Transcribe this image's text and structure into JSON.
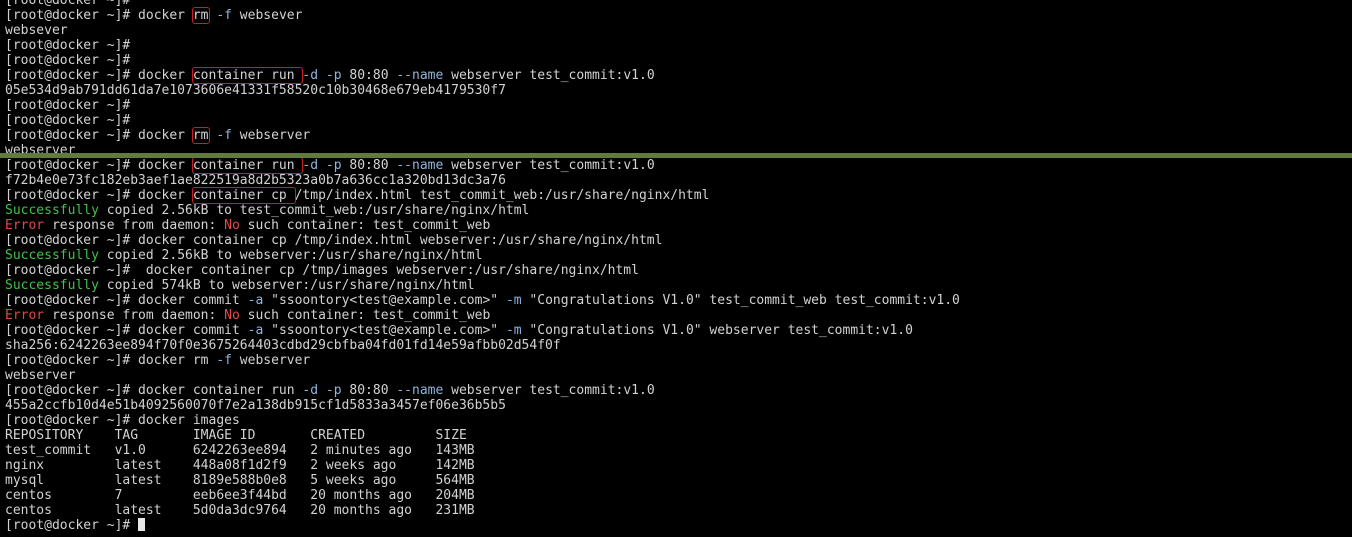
{
  "prompt": "[root@docker ~]#",
  "colors": {
    "background": "#000000",
    "text": "#d2d2d2",
    "success": "#44c04b",
    "error": "#e04848",
    "option": "#8fb4dc",
    "highlight_box": "#c62020",
    "divider": "#5f7f2e"
  },
  "top_pane": [
    {
      "segs": [
        {
          "text": "[root@docker ~]#"
        }
      ]
    },
    {
      "segs": [
        {
          "text": "[root@docker ~]# docker "
        },
        {
          "text": "rm",
          "cls": "hl",
          "name": "highlight-rm"
        },
        {
          "text": " "
        },
        {
          "text": "-f",
          "cls": "flag"
        },
        {
          "text": " websever"
        }
      ]
    },
    {
      "segs": [
        {
          "text": "websever"
        }
      ]
    },
    {
      "segs": [
        {
          "text": "[root@docker ~]#"
        }
      ]
    },
    {
      "segs": [
        {
          "text": "[root@docker ~]#"
        }
      ]
    },
    {
      "segs": [
        {
          "text": "[root@docker ~]# docker "
        },
        {
          "text": "container run ",
          "cls": "hl",
          "name": "highlight-container-run"
        },
        {
          "text": "-d",
          "cls": "flag"
        },
        {
          "text": " "
        },
        {
          "text": "-p",
          "cls": "flag"
        },
        {
          "text": " 80:80 "
        },
        {
          "text": "--name",
          "cls": "flag"
        },
        {
          "text": " webserver test_commit:v1.0"
        }
      ]
    },
    {
      "segs": [
        {
          "text": "05e534d9ab791dd61da7e1073606e41331f58520c10b30468e679eb4179530f7"
        }
      ]
    },
    {
      "segs": [
        {
          "text": "[root@docker ~]#"
        }
      ]
    },
    {
      "segs": [
        {
          "text": "[root@docker ~]#"
        }
      ]
    },
    {
      "segs": [
        {
          "text": "[root@docker ~]# docker "
        },
        {
          "text": "rm",
          "cls": "hl",
          "name": "highlight-rm"
        },
        {
          "text": " "
        },
        {
          "text": "-f",
          "cls": "flag"
        },
        {
          "text": " webserver"
        }
      ]
    },
    {
      "segs": [
        {
          "text": "webserver"
        }
      ]
    }
  ],
  "bottom_pane": [
    {
      "segs": [
        {
          "text": "[root@docker ~]# docker "
        },
        {
          "text": "container run ",
          "cls": "hl",
          "name": "highlight-container-run"
        },
        {
          "text": "-d",
          "cls": "flag"
        },
        {
          "text": " "
        },
        {
          "text": "-p",
          "cls": "flag"
        },
        {
          "text": " 80:80 "
        },
        {
          "text": "--name",
          "cls": "flag"
        },
        {
          "text": " webserver test_commit:v1.0"
        }
      ]
    },
    {
      "segs": [
        {
          "text": "f72b4e0e73fc182eb3aef1ae822519a8d2b5323a0b7a636cc1a320bd13dc3a76"
        }
      ]
    },
    {
      "segs": [
        {
          "text": "[root@docker ~]# docker "
        },
        {
          "text": "container cp ",
          "cls": "hl",
          "name": "highlight-container-cp"
        },
        {
          "text": "/tmp/index.html test_commit_web:/usr/share/nginx/html"
        }
      ]
    },
    {
      "segs": [
        {
          "text": "Successfully",
          "cls": "ok"
        },
        {
          "text": " copied 2.56kB to test_commit_web:/usr/share/nginx/html"
        }
      ]
    },
    {
      "segs": [
        {
          "text": "Error",
          "cls": "err"
        },
        {
          "text": " response from daemon: "
        },
        {
          "text": "No",
          "cls": "no"
        },
        {
          "text": " such container: test_commit_web"
        }
      ]
    },
    {
      "segs": [
        {
          "text": "[root@docker ~]# docker container cp /tmp/index.html webserver:/usr/share/nginx/html"
        }
      ]
    },
    {
      "segs": [
        {
          "text": "Successfully",
          "cls": "ok"
        },
        {
          "text": " copied 2.56kB to webserver:/usr/share/nginx/html"
        }
      ]
    },
    {
      "segs": [
        {
          "text": "[root@docker ~]#  docker container cp /tmp/images webserver:/usr/share/nginx/html"
        }
      ]
    },
    {
      "segs": [
        {
          "text": "Successfully",
          "cls": "ok"
        },
        {
          "text": " copied 574kB to webserver:/usr/share/nginx/html"
        }
      ]
    },
    {
      "segs": [
        {
          "text": "[root@docker ~]# docker commit "
        },
        {
          "text": "-a",
          "cls": "flag"
        },
        {
          "text": " \"ssoontory<test@example.com>\" "
        },
        {
          "text": "-m",
          "cls": "flag"
        },
        {
          "text": " \"Congratulations V1.0\" test_commit_web test_commit:v1.0"
        }
      ]
    },
    {
      "segs": [
        {
          "text": "Error",
          "cls": "err"
        },
        {
          "text": " response from daemon: "
        },
        {
          "text": "No",
          "cls": "no"
        },
        {
          "text": " such container: test_commit_web"
        }
      ]
    },
    {
      "segs": [
        {
          "text": "[root@docker ~]# docker commit "
        },
        {
          "text": "-a",
          "cls": "flag"
        },
        {
          "text": " \"ssoontory<test@example.com>\" "
        },
        {
          "text": "-m",
          "cls": "flag"
        },
        {
          "text": " \"Congratulations V1.0\" webserver test_commit:v1.0"
        }
      ]
    },
    {
      "segs": [
        {
          "text": "sha256:6242263ee894f70f0e3675264403cdbd29cbfba04fd01fd14e59afbb02d54f0f"
        }
      ]
    },
    {
      "segs": [
        {
          "text": "[root@docker ~]# docker rm "
        },
        {
          "text": "-f",
          "cls": "flag"
        },
        {
          "text": " webserver"
        }
      ]
    },
    {
      "segs": [
        {
          "text": "webserver"
        }
      ]
    },
    {
      "segs": [
        {
          "text": "[root@docker ~]# docker container run "
        },
        {
          "text": "-d",
          "cls": "flag"
        },
        {
          "text": " "
        },
        {
          "text": "-p",
          "cls": "flag"
        },
        {
          "text": " 80:80 "
        },
        {
          "text": "--name",
          "cls": "flag"
        },
        {
          "text": " webserver test_commit:v1.0"
        }
      ]
    },
    {
      "segs": [
        {
          "text": "455a2ccfb10d4e51b4092560070f7e2a138db915cf1d5833a3457ef06e36b5b5"
        }
      ]
    },
    {
      "segs": [
        {
          "text": "[root@docker ~]# docker images"
        }
      ]
    },
    {
      "segs": [
        {
          "text": "REPOSITORY    TAG       IMAGE ID       CREATED         SIZE"
        }
      ]
    },
    {
      "segs": [
        {
          "text": "test_commit   v1.0      6242263ee894   2 minutes ago   143MB"
        }
      ]
    },
    {
      "segs": [
        {
          "text": "nginx         latest    448a08f1d2f9   2 weeks ago     142MB"
        }
      ]
    },
    {
      "segs": [
        {
          "text": "mysql         latest    8189e588b0e8   5 weeks ago     564MB"
        }
      ]
    },
    {
      "segs": [
        {
          "text": "centos        7         eeb6ee3f44bd   20 months ago   204MB"
        }
      ]
    },
    {
      "segs": [
        {
          "text": "centos        latest    5d0da3dc9764   20 months ago   231MB"
        }
      ]
    },
    {
      "segs": [
        {
          "text": "[root@docker ~]# "
        },
        {
          "cursor": true
        }
      ]
    }
  ]
}
